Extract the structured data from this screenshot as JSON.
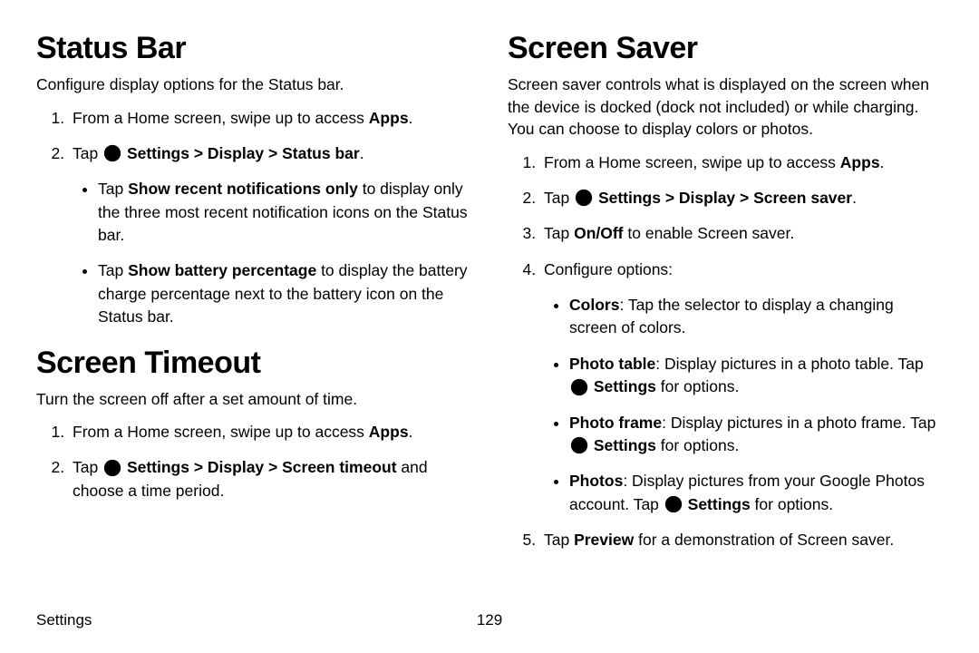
{
  "left": {
    "section1": {
      "heading": "Status Bar",
      "intro": "Configure display options for the Status bar.",
      "step1_a": "From a Home screen, swipe up to access ",
      "step1_b": "Apps",
      "step1_c": ".",
      "step2_a": "Tap ",
      "step2_b": " Settings > Display > Status bar",
      "step2_c": ".",
      "bullet1_a": "Tap ",
      "bullet1_b": "Show recent notifications only",
      "bullet1_c": " to display only the three most recent notification icons on the Status bar.",
      "bullet2_a": "Tap ",
      "bullet2_b": "Show battery percentage",
      "bullet2_c": " to display the battery charge percentage next to the battery icon on the Status bar."
    },
    "section2": {
      "heading": "Screen Timeout",
      "intro": "Turn the screen off after a set amount of time.",
      "step1_a": "From a Home screen, swipe up to access ",
      "step1_b": "Apps",
      "step1_c": ".",
      "step2_a": "Tap ",
      "step2_b": " Settings > Display > Screen timeout",
      "step2_c": " and choose a time period."
    }
  },
  "right": {
    "section1": {
      "heading": "Screen Saver",
      "intro": "Screen saver controls what is displayed on the screen when the device is docked (dock not included) or while charging. You can choose to display colors or photos.",
      "step1_a": "From a Home screen, swipe up to access ",
      "step1_b": "Apps",
      "step1_c": ".",
      "step2_a": "Tap ",
      "step2_b": " Settings > Display > Screen saver",
      "step2_c": ".",
      "step3_a": "Tap ",
      "step3_b": "On/Off",
      "step3_c": " to enable Screen saver.",
      "step4": "Configure options:",
      "b1_a": "Colors",
      "b1_b": ": Tap the selector to display a changing screen of colors.",
      "b2_a": "Photo table",
      "b2_b": ": Display pictures in a photo table. Tap ",
      "b2_c": " Settings",
      "b2_d": " for options.",
      "b3_a": "Photo frame",
      "b3_b": ": Display pictures in a photo frame. Tap ",
      "b3_c": " Settings",
      "b3_d": " for options.",
      "b4_a": "Photos",
      "b4_b": ": Display pictures from your Google Photos account. Tap ",
      "b4_c": " Settings",
      "b4_d": " for options.",
      "step5_a": "Tap ",
      "step5_b": "Preview",
      "step5_c": " for a demonstration of Screen saver."
    }
  },
  "footer": {
    "label": "Settings",
    "page": "129"
  }
}
